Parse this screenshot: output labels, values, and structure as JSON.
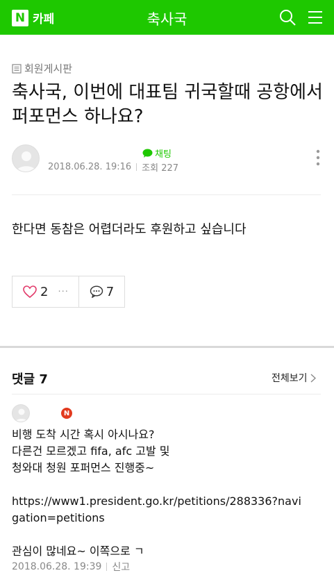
{
  "header": {
    "logo_mark": "N",
    "logo_text": "카페",
    "title": "축사국",
    "brand_color": "#1ec800",
    "icons": [
      "search-icon",
      "menu-icon"
    ]
  },
  "post": {
    "board": "회원게시판",
    "title": "축사국, 이번에 대표팀 귀국할때 공항에서 퍼포먼스 하나요?",
    "chat_label": "채팅",
    "date": "2018.06.28. 19:16",
    "views": "조회 227",
    "body": "한다면 동참은 어렵더라도 후원하고 싶습니다",
    "likes": "2",
    "like_more": "···",
    "comments": "7"
  },
  "comments_section": {
    "header": "댓글 7",
    "view_all": "전체보기",
    "items": [
      {
        "badge": "N",
        "lines": [
          "비행 도착 시간 혹시 아시나요?",
          "다른건 모르겠고 fifa, afc 고발 및",
          "청와대 청원 포퍼먼스 진행중~",
          "",
          "https://www1.president.go.kr/petitions/288336?navi",
          "gation=petitions",
          "",
          "관심이 많네요~ 이쪽으로 ㄱ"
        ],
        "date": "2018.06.28. 19:39",
        "report": "신고"
      }
    ]
  }
}
